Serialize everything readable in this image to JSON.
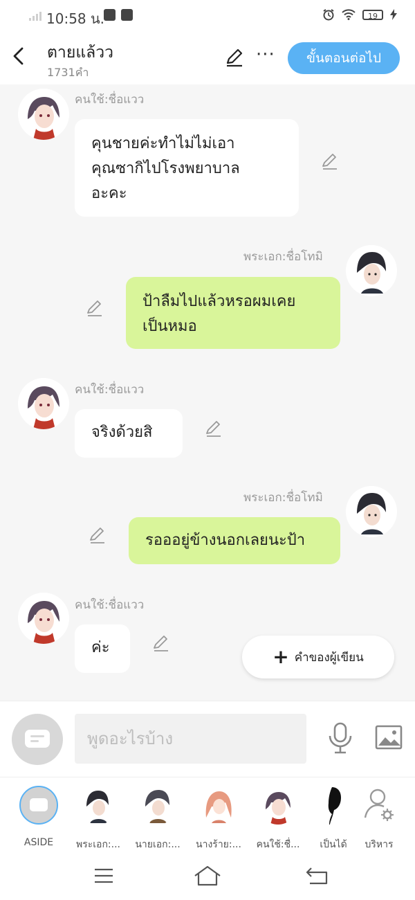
{
  "status_bar": {
    "time": "10:58 น.",
    "battery": "19"
  },
  "header": {
    "title": "ตายแล้วว",
    "word_count": "1731คำ",
    "next_button": "ขั้นตอนต่อไป",
    "more": "···"
  },
  "messages": [
    {
      "side": "left",
      "speaker": "คนใช้:ชื่อแวว",
      "lines": [
        "คุนชายค่ะทำไม่ไม่เอา",
        "คุณซากิไปโรงพยาบาล",
        "อะคะ"
      ]
    },
    {
      "side": "right",
      "speaker": "พระเอก:ชื่อโทมิ",
      "lines": [
        "ป้าลืมไปแล้วหรอผมเคย",
        "เป็นหมอ"
      ]
    },
    {
      "side": "left",
      "speaker": "คนใช้:ชื่อแวว",
      "lines": [
        "จริงด้วยสิ"
      ]
    },
    {
      "side": "right",
      "speaker": "พระเอก:ชื่อโทมิ",
      "lines": [
        "รอออยู่ข้างนอกเลยนะป้า"
      ]
    },
    {
      "side": "left",
      "speaker": "คนใช้:ชื่อแวว",
      "lines": [
        "ค่ะ"
      ]
    }
  ],
  "fab": {
    "plus": "+",
    "label": "คำของผู้เขียน"
  },
  "input": {
    "placeholder": "พูดอะไรบ้าง"
  },
  "characters": [
    {
      "label": "ASIDE"
    },
    {
      "label": "พระเอก:..."
    },
    {
      "label": "นายเอก:..."
    },
    {
      "label": "นางร้าย:..."
    },
    {
      "label": "คนใช้:ชื่..."
    },
    {
      "label": "เป็นได้"
    },
    {
      "label": "บริหาร"
    }
  ],
  "colors": {
    "accent": "#5ab2f4",
    "right_bubble": "#d9f59a",
    "left_bubble": "#ffffff"
  }
}
